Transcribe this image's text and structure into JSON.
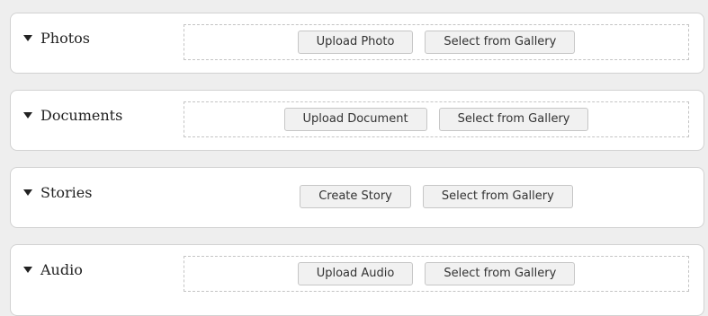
{
  "sections": [
    {
      "title": "Photos",
      "primary_label": "Upload Photo",
      "secondary_label": "Select from Gallery",
      "has_dropzone": true
    },
    {
      "title": "Documents",
      "primary_label": "Upload Document",
      "secondary_label": "Select from Gallery",
      "has_dropzone": true
    },
    {
      "title": "Stories",
      "primary_label": "Create Story",
      "secondary_label": "Select from Gallery",
      "has_dropzone": false
    },
    {
      "title": "Audio",
      "primary_label": "Upload Audio",
      "secondary_label": "Select from Gallery",
      "has_dropzone": true
    }
  ],
  "colors": {
    "background": "#eeeeee",
    "panel": "#ffffff",
    "button_bg": "#f1f1f1",
    "dashed_border": "#c4c4c4"
  }
}
